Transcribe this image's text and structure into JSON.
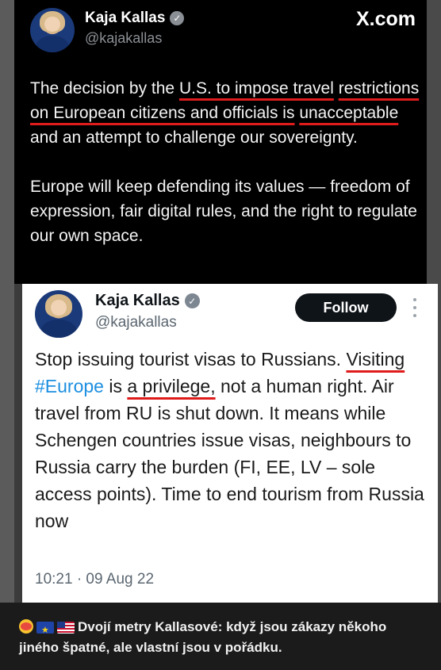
{
  "top_tweet": {
    "name": "Kaja Kallas",
    "handle": "@kajakallas",
    "watermark": "X.com",
    "para1": {
      "lead": "The decision by the ",
      "u1": "U.S. to impose travel",
      "sp": " ",
      "u2": "restrictions on European citizens and officials is",
      "sp2": " ",
      "u3": "unacceptable",
      "rest": " and an attempt to challenge our sovereignty."
    },
    "para2": "Europe will keep defending its values — freedom of expression, fair digital rules, and the right to regulate our own space."
  },
  "embedded_tweet": {
    "name": "Kaja Kallas",
    "handle": "@kajakallas",
    "follow_label": "Follow",
    "text": {
      "part1": "Stop issuing tourist visas to Russians. ",
      "u1": "Visiting",
      "sp": " ",
      "hashtag": "#Europe",
      "is": " is ",
      "u2": "a privilege,",
      "rest": " not a human right. Air travel from RU is shut down. It means while Schengen countries issue visas, neighbours to Russia carry the burden (FI, EE, LV – sole access points). Time to end tourism from Russia now"
    },
    "timestamp": "10:21 · 09 Aug 22"
  },
  "caption": {
    "text": "Dvojí metry Kallasové: když jsou zákazy někoho jiného špatné, ale vlastní jsou v pořádku.",
    "emojis": [
      "clown-face-emoji",
      "eu-flag-emoji",
      "us-flag-emoji"
    ]
  },
  "colors": {
    "underline": "#e01b1b",
    "hashtag": "#1d8fe0",
    "follow_bg": "#0f1419"
  }
}
